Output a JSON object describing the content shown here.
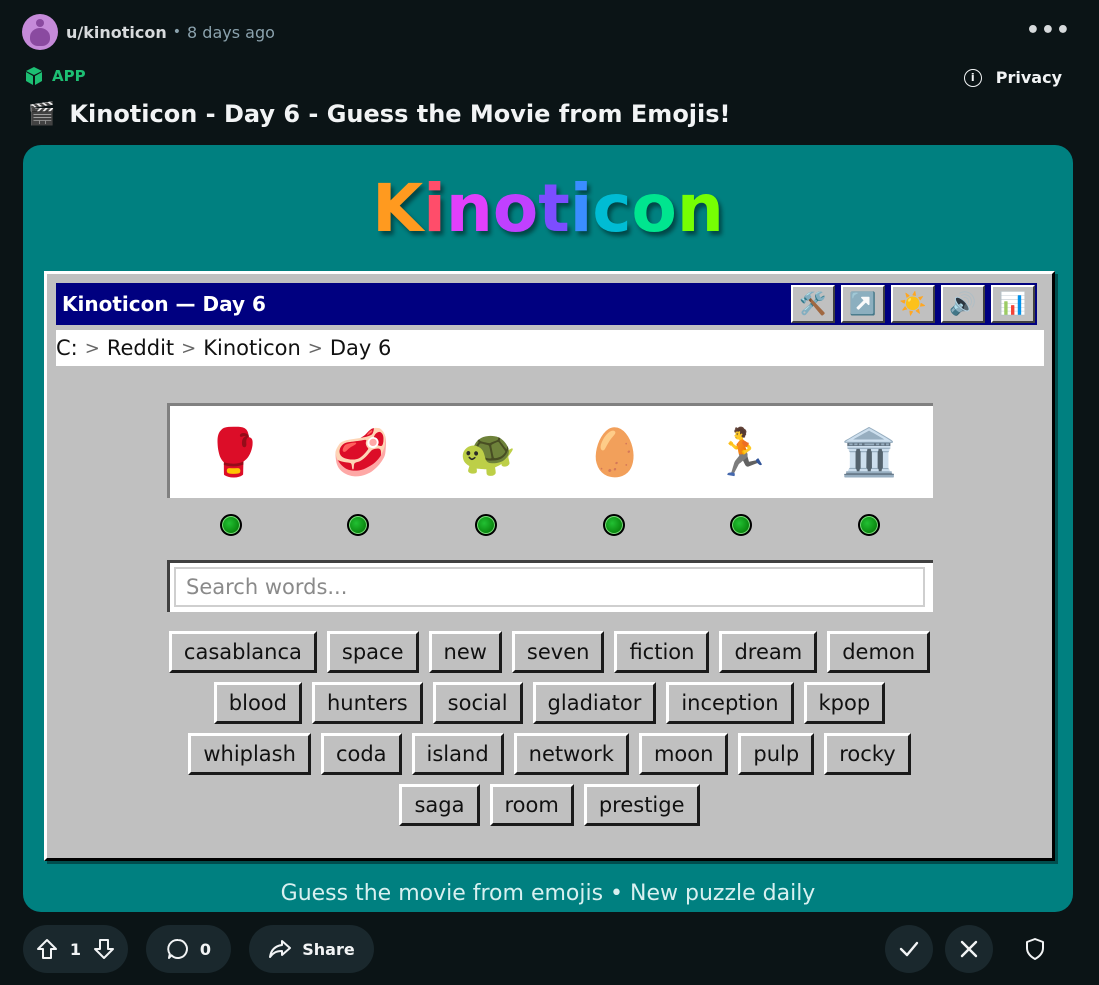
{
  "post": {
    "username": "u/kinoticon",
    "separator": "•",
    "time": "8 days ago",
    "more_label": "•••",
    "app_label": "APP",
    "privacy_label": "Privacy",
    "title_emoji": "🎬",
    "title": "Kinoticon - Day 6 - Guess the Movie from Emojis!"
  },
  "app": {
    "logo": [
      "K",
      "i",
      "n",
      "o",
      "t",
      "i",
      "c",
      "o",
      "n"
    ],
    "logo_colors": [
      "#ff9a1f",
      "#ff4d6a",
      "#e040fb",
      "#c040ff",
      "#7c4dff",
      "#3a8dff",
      "#00bcd4",
      "#00e58f",
      "#76ff03"
    ],
    "window_title": "Kinoticon — Day 6",
    "toolbar": [
      {
        "name": "tools-icon",
        "glyph": "🛠️"
      },
      {
        "name": "external-link-icon",
        "glyph": "↗️"
      },
      {
        "name": "sun-icon",
        "glyph": "☀️"
      },
      {
        "name": "speaker-icon",
        "glyph": "🔊"
      },
      {
        "name": "stats-icon",
        "glyph": "📊"
      }
    ],
    "breadcrumb": [
      "C:",
      "Reddit",
      "Kinoticon",
      "Day 6"
    ],
    "breadcrumb_sep": ">",
    "emojis": [
      {
        "glyph": "🥊",
        "name": "boxing-glove-emoji"
      },
      {
        "glyph": "🥩",
        "name": "steak-emoji"
      },
      {
        "glyph": "🐢",
        "name": "turtle-emoji"
      },
      {
        "glyph": "🥚",
        "name": "egg-emoji"
      },
      {
        "glyph": "🏃",
        "name": "runner-emoji"
      },
      {
        "glyph": "🏛️",
        "name": "classical-building-emoji"
      }
    ],
    "status_colors": [
      "#22c033",
      "#22c033",
      "#22c033",
      "#22c033",
      "#22c033",
      "#22c033"
    ],
    "search_placeholder": "Search words...",
    "words": [
      "casablanca",
      "space",
      "new",
      "seven",
      "fiction",
      "dream",
      "demon",
      "blood",
      "hunters",
      "social",
      "gladiator",
      "inception",
      "kpop",
      "whiplash",
      "coda",
      "island",
      "network",
      "moon",
      "pulp",
      "rocky",
      "saga",
      "room",
      "prestige"
    ],
    "footer": "Guess the movie from emojis • New puzzle daily"
  },
  "actions": {
    "vote_count": "1",
    "comment_count": "0",
    "share_label": "Share"
  },
  "colors": {
    "background": "#0b1416",
    "card": "#008080",
    "titlebar": "#000080",
    "app_tag": "#1dbf73"
  }
}
